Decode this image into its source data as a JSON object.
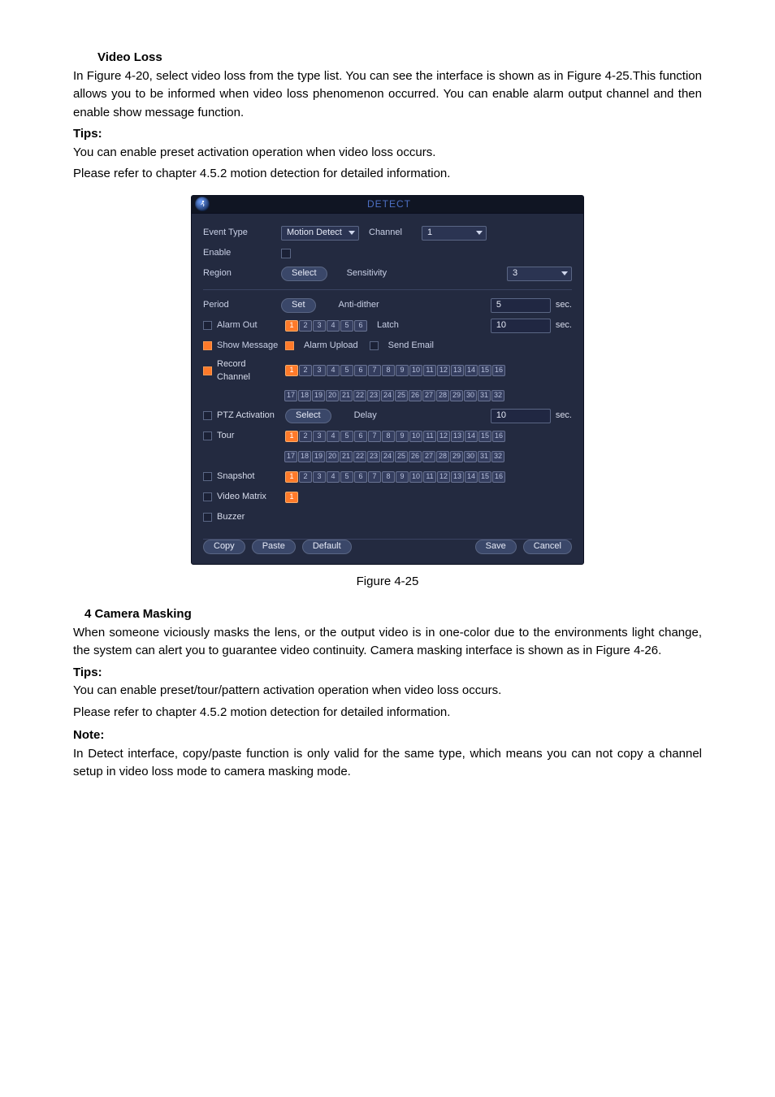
{
  "section1": {
    "heading": "Video Loss",
    "p1": "In Figure 4-20, select video loss from the type list. You can see the interface is shown as in Figure 4-25.This function allows you to be informed when video loss phenomenon occurred. You can enable alarm output channel and then enable show message function.",
    "tips_label": "Tips:",
    "tips1": "You can enable preset activation operation when video loss occurs.",
    "tips2": "Please refer to chapter 4.5.2 motion detection for detailed information."
  },
  "detect": {
    "corner_icon": "person-running-icon",
    "title": "DETECT",
    "labels": {
      "event_type": "Event Type",
      "enable": "Enable",
      "region": "Region",
      "period": "Period",
      "alarm_out": "Alarm Out",
      "show_message": "Show Message",
      "record_channel": "Record Channel",
      "ptz_activation": "PTZ Activation",
      "tour": "Tour",
      "snapshot": "Snapshot",
      "video_matrix": "Video Matrix",
      "buzzer": "Buzzer",
      "channel": "Channel",
      "sensitivity": "Sensitivity",
      "anti_dither": "Anti-dither",
      "latch": "Latch",
      "alarm_upload": "Alarm Upload",
      "send_email": "Send Email",
      "delay": "Delay",
      "sec": "sec."
    },
    "buttons": {
      "select": "Select",
      "set": "Set",
      "copy": "Copy",
      "paste": "Paste",
      "default": "Default",
      "save": "Save",
      "cancel": "Cancel"
    },
    "values": {
      "event_type": "Motion Detect",
      "channel": "1",
      "sensitivity": "3",
      "anti_dither": "5",
      "latch": "10",
      "delay": "10"
    },
    "channels16": [
      "1",
      "2",
      "3",
      "4",
      "5",
      "6",
      "7",
      "8",
      "9",
      "10",
      "11",
      "12",
      "13",
      "14",
      "15",
      "16"
    ],
    "channels32b": [
      "17",
      "18",
      "19",
      "20",
      "21",
      "22",
      "23",
      "24",
      "25",
      "26",
      "27",
      "28",
      "29",
      "30",
      "31",
      "32"
    ],
    "alarm_out_channels": [
      "1",
      "2",
      "3",
      "4",
      "5",
      "6"
    ]
  },
  "figure_caption": "Figure 4-25",
  "section2": {
    "heading": "4 Camera Masking",
    "p1": "When someone viciously masks the lens, or the output video is in one-color due to the environments light change, the system can alert you to guarantee video continuity. Camera masking interface is shown as in Figure 4-26.",
    "tips_label": "Tips:",
    "tips1": "You can enable preset/tour/pattern activation operation when video loss occurs.",
    "tips2": "Please refer to chapter 4.5.2 motion detection for detailed information.",
    "note_label": "Note:",
    "note1": "In Detect interface, copy/paste function is only valid for the same type, which means you can not copy a channel setup in video loss mode to camera masking mode."
  }
}
